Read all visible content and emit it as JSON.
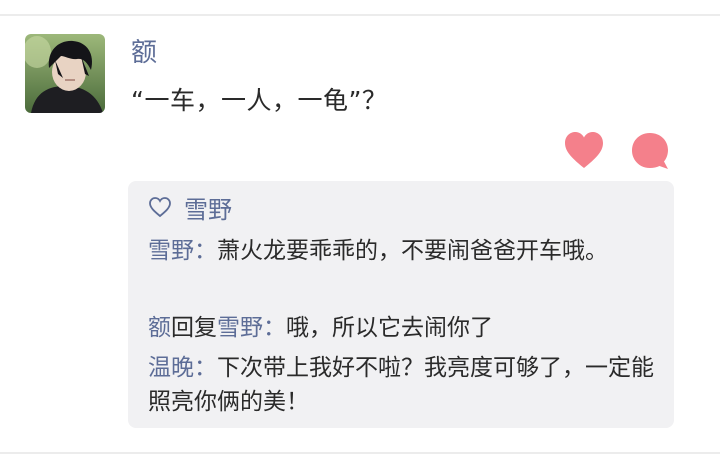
{
  "post": {
    "username": "额",
    "text": "“一车，一人，一龟”？"
  },
  "actions": {
    "like_icon": "heart-icon",
    "comment_icon": "comment-bubble-icon",
    "accent_color": "#f4808b"
  },
  "likes": {
    "icon": "heart-outline-icon",
    "users": "雪野"
  },
  "comments": [
    {
      "author": "雪野",
      "separator": "：",
      "text": "萧火龙要乖乖的，不要闹爸爸开车哦。"
    },
    {
      "author": "额",
      "reply_word": "回复",
      "reply_to": "雪野",
      "separator": "：",
      "text": "哦，所以它去闹你了"
    },
    {
      "author": "温晚",
      "separator": "：",
      "text": "下次带上我好不啦？我亮度可够了，一定能照亮你俩的美！"
    }
  ],
  "colors": {
    "name": "#5d6d97",
    "text": "#2a2a2a",
    "comment_bg": "#f1f1f3"
  }
}
